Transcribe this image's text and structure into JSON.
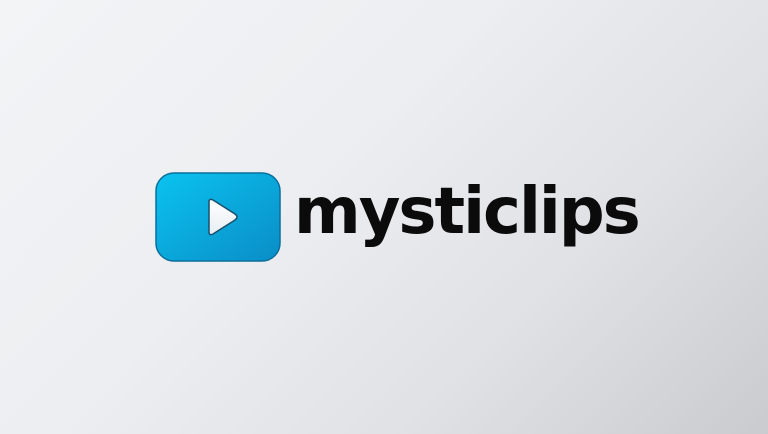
{
  "app": {
    "brand_name": "mysticlips",
    "logo_icon": "play-icon"
  },
  "colors": {
    "badge_light": "#0ac3ef",
    "badge_dark": "#0a8dc7",
    "wordmark": "#0b0b0c"
  }
}
